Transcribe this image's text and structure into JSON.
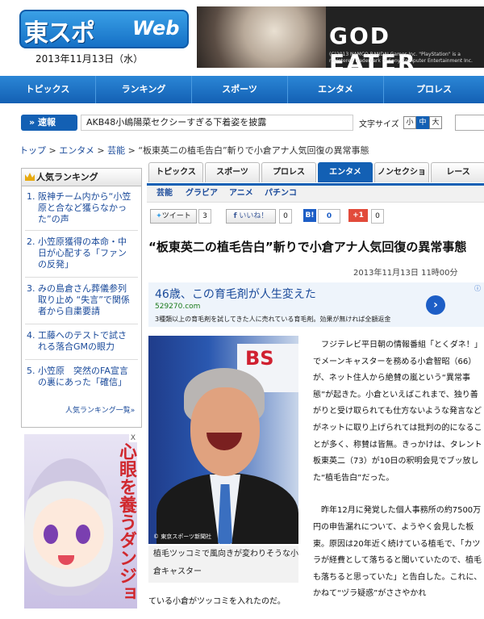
{
  "header": {
    "logo_jp": "東スポ",
    "logo_web": "Web",
    "date": "2013年11月13日（水）"
  },
  "banner": {
    "title": "GOD EATER",
    "sub": "(C)2013 NAMCO BANDAI Games Inc. \"PlayStation\" is a registered trademark of Sony Computer Entertainment Inc."
  },
  "nav": [
    "トピックス",
    "ランキング",
    "スポーツ",
    "エンタメ",
    "プロレス"
  ],
  "ticker": {
    "label": "速報",
    "text": "AKB48小嶋陽菜セクシーすぎる下着姿を披露"
  },
  "font_size": {
    "label": "文字サイズ",
    "small": "小",
    "medium": "中",
    "large": "大"
  },
  "breadcrumb": {
    "items": [
      "トップ",
      "エンタメ",
      "芸能"
    ],
    "current": "“板東英二の植毛告白”斬りで小倉アナ人気回復の異常事態"
  },
  "ranking": {
    "title": "人気ランキング",
    "items": [
      {
        "num": "1.",
        "text": "阪神チーム内から“小笠原と合など獲らなかった”の声"
      },
      {
        "num": "2.",
        "text": "小笠原獲得の本命・中日が心配する「ファンの反発」"
      },
      {
        "num": "3.",
        "text": "みの島倉さん葬儀参列取り止め “失言”で関係者から自粛要請"
      },
      {
        "num": "4.",
        "text": "工藤へのテストで試される落合GMの眼力"
      },
      {
        "num": "5.",
        "text": "小笠原　突然のFA宣言の裏にあった「確信」"
      }
    ],
    "more": "人気ランキング一覧»"
  },
  "left_ad": {
    "text": "心眼を養うダンジョ",
    "close": "X"
  },
  "tabs": [
    "トピックス",
    "スポーツ",
    "プロレス",
    "エンタメ",
    "ノンセクション",
    "レース"
  ],
  "active_tab": "エンタメ",
  "subtabs": [
    "芸能",
    "グラビア",
    "アニメ",
    "パチンコ"
  ],
  "share": {
    "tweet": "ツイート",
    "tweet_count": "3",
    "facebook": "いいね！",
    "facebook_count": "0",
    "hatena": "B!",
    "hatena_count": "0",
    "gplus": "+1",
    "gplus_count": "0"
  },
  "article": {
    "headline": "“板東英二の植毛告白”斬りで小倉アナ人気回復の異常事態",
    "date": "2013年11月13日 11時00分",
    "paragraphs": [
      "フジテレビ平日朝の情報番組「とくダネ！」でメーンキャスターを務める小倉智昭（66）が、ネット住人から絶賛の嵐という“異常事態”が起きた。小倉といえばこれまで、独り善がりと受け取られても仕方ないような発言などがネットに取り上げられては批判の的になることが多く、称賛は皆無。きっかけは、タレント板東英二（73）が10日の釈明会見でブッ放した“植毛告白”だった。",
      "昨年12月に発覚した個人事務所の約7500万円の申告漏れについて、ようやく会見した板東。原因は20年近く続けている植毛で、「カツラが経費として落ちると聞いていたので、植毛も落ちると思っていた」と告白した。これに、かねて“ヅラ疑惑”がささやかれ"
    ],
    "tail": "ている小倉がツッコミを入れたのだ。",
    "photo_credit": "© 東京スポーツ新聞社",
    "photo_sign": "BS",
    "caption": "植毛ツッコミで風向きが変わりそうな小倉キャスター"
  },
  "text_ad": {
    "title": "46歳、この育毛剤が人生変えた",
    "url": "529270.com",
    "desc": "3種類以上の育毛剤を試してきた人に売れている育毛剤。効果が無ければ全額返金",
    "arrow": "›",
    "info": "ⓘ"
  },
  "colors": {
    "nav": "#1360b4",
    "link": "#1a4a9a",
    "accent": "#2b86d6"
  }
}
